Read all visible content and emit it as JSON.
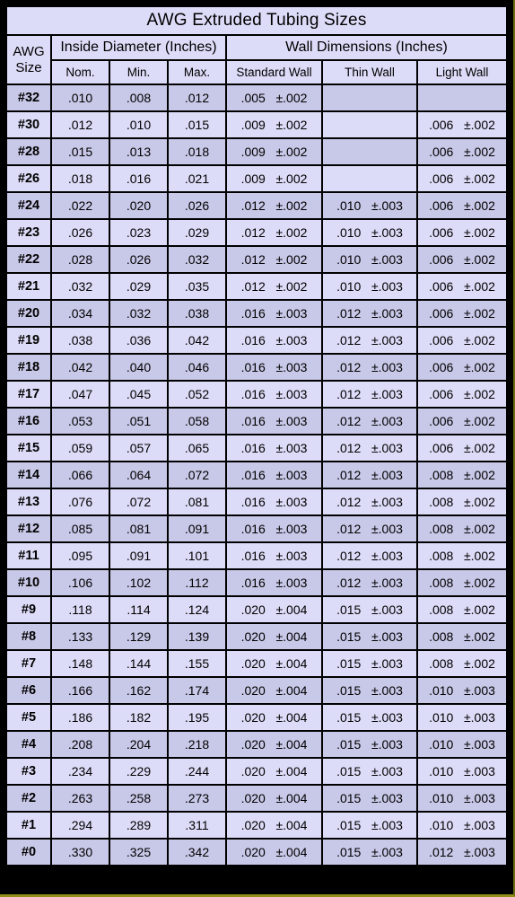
{
  "title": "AWG Extruded Tubing Sizes",
  "headers": {
    "awg_size": "AWG\nSize",
    "awg_size_line1": "AWG",
    "awg_size_line2": "Size",
    "inside_diameter": "Inside Diameter (Inches)",
    "wall_dimensions": "Wall Dimensions (Inches)",
    "nom": "Nom.",
    "min": "Min.",
    "max": "Max.",
    "standard_wall": "Standard Wall",
    "thin_wall": "Thin Wall",
    "light_wall": "Light Wall"
  },
  "colors": {
    "cell_light": "#dcdcf8",
    "cell_dark": "#c8c8e8",
    "border": "#000000",
    "frame_edge": "#8f8f18",
    "text": "#000000"
  },
  "rows": [
    {
      "awg": "#32",
      "nom": ".010",
      "min": ".008",
      "max": ".012",
      "standard": ".005   ±.002",
      "thin": "",
      "light": ""
    },
    {
      "awg": "#30",
      "nom": ".012",
      "min": ".010",
      "max": ".015",
      "standard": ".009   ±.002",
      "thin": "",
      "light": ".006   ±.002"
    },
    {
      "awg": "#28",
      "nom": ".015",
      "min": ".013",
      "max": ".018",
      "standard": ".009   ±.002",
      "thin": "",
      "light": ".006   ±.002"
    },
    {
      "awg": "#26",
      "nom": ".018",
      "min": ".016",
      "max": ".021",
      "standard": ".009   ±.002",
      "thin": "",
      "light": ".006   ±.002"
    },
    {
      "awg": "#24",
      "nom": ".022",
      "min": ".020",
      "max": ".026",
      "standard": ".012   ±.002",
      "thin": ".010   ±.003",
      "light": ".006   ±.002"
    },
    {
      "awg": "#23",
      "nom": ".026",
      "min": ".023",
      "max": ".029",
      "standard": ".012   ±.002",
      "thin": ".010   ±.003",
      "light": ".006   ±.002"
    },
    {
      "awg": "#22",
      "nom": ".028",
      "min": ".026",
      "max": ".032",
      "standard": ".012   ±.002",
      "thin": ".010   ±.003",
      "light": ".006   ±.002"
    },
    {
      "awg": "#21",
      "nom": ".032",
      "min": ".029",
      "max": ".035",
      "standard": ".012   ±.002",
      "thin": ".010   ±.003",
      "light": ".006   ±.002"
    },
    {
      "awg": "#20",
      "nom": ".034",
      "min": ".032",
      "max": ".038",
      "standard": ".016   ±.003",
      "thin": ".012   ±.003",
      "light": ".006   ±.002"
    },
    {
      "awg": "#19",
      "nom": ".038",
      "min": ".036",
      "max": ".042",
      "standard": ".016   ±.003",
      "thin": ".012   ±.003",
      "light": ".006   ±.002"
    },
    {
      "awg": "#18",
      "nom": ".042",
      "min": ".040",
      "max": ".046",
      "standard": ".016   ±.003",
      "thin": ".012   ±.003",
      "light": ".006   ±.002"
    },
    {
      "awg": "#17",
      "nom": ".047",
      "min": ".045",
      "max": ".052",
      "standard": ".016   ±.003",
      "thin": ".012   ±.003",
      "light": ".006   ±.002"
    },
    {
      "awg": "#16",
      "nom": ".053",
      "min": ".051",
      "max": ".058",
      "standard": ".016   ±.003",
      "thin": ".012   ±.003",
      "light": ".006   ±.002"
    },
    {
      "awg": "#15",
      "nom": ".059",
      "min": ".057",
      "max": ".065",
      "standard": ".016   ±.003",
      "thin": ".012   ±.003",
      "light": ".006   ±.002"
    },
    {
      "awg": "#14",
      "nom": ".066",
      "min": ".064",
      "max": ".072",
      "standard": ".016   ±.003",
      "thin": ".012   ±.003",
      "light": ".008   ±.002"
    },
    {
      "awg": "#13",
      "nom": ".076",
      "min": ".072",
      "max": ".081",
      "standard": ".016   ±.003",
      "thin": ".012   ±.003",
      "light": ".008   ±.002"
    },
    {
      "awg": "#12",
      "nom": ".085",
      "min": ".081",
      "max": ".091",
      "standard": ".016   ±.003",
      "thin": ".012   ±.003",
      "light": ".008   ±.002"
    },
    {
      "awg": "#11",
      "nom": ".095",
      "min": ".091",
      "max": ".101",
      "standard": ".016   ±.003",
      "thin": ".012   ±.003",
      "light": ".008   ±.002"
    },
    {
      "awg": "#10",
      "nom": ".106",
      "min": ".102",
      "max": ".112",
      "standard": ".016   ±.003",
      "thin": ".012   ±.003",
      "light": ".008   ±.002"
    },
    {
      "awg": "#9",
      "nom": ".118",
      "min": ".114",
      "max": ".124",
      "standard": ".020   ±.004",
      "thin": ".015   ±.003",
      "light": ".008   ±.002"
    },
    {
      "awg": "#8",
      "nom": ".133",
      "min": ".129",
      "max": ".139",
      "standard": ".020   ±.004",
      "thin": ".015   ±.003",
      "light": ".008   ±.002"
    },
    {
      "awg": "#7",
      "nom": ".148",
      "min": ".144",
      "max": ".155",
      "standard": ".020   ±.004",
      "thin": ".015   ±.003",
      "light": ".008   ±.002"
    },
    {
      "awg": "#6",
      "nom": ".166",
      "min": ".162",
      "max": ".174",
      "standard": ".020   ±.004",
      "thin": ".015   ±.003",
      "light": ".010   ±.003"
    },
    {
      "awg": "#5",
      "nom": ".186",
      "min": ".182",
      "max": ".195",
      "standard": ".020   ±.004",
      "thin": ".015   ±.003",
      "light": ".010   ±.003"
    },
    {
      "awg": "#4",
      "nom": ".208",
      "min": ".204",
      "max": ".218",
      "standard": ".020   ±.004",
      "thin": ".015   ±.003",
      "light": ".010   ±.003"
    },
    {
      "awg": "#3",
      "nom": ".234",
      "min": ".229",
      "max": ".244",
      "standard": ".020   ±.004",
      "thin": ".015   ±.003",
      "light": ".010   ±.003"
    },
    {
      "awg": "#2",
      "nom": ".263",
      "min": ".258",
      "max": ".273",
      "standard": ".020   ±.004",
      "thin": ".015   ±.003",
      "light": ".010   ±.003"
    },
    {
      "awg": "#1",
      "nom": ".294",
      "min": ".289",
      "max": ".311",
      "standard": ".020   ±.004",
      "thin": ".015   ±.003",
      "light": ".010   ±.003"
    },
    {
      "awg": "#0",
      "nom": ".330",
      "min": ".325",
      "max": ".342",
      "standard": ".020   ±.004",
      "thin": ".015   ±.003",
      "light": ".012   ±.003"
    }
  ]
}
